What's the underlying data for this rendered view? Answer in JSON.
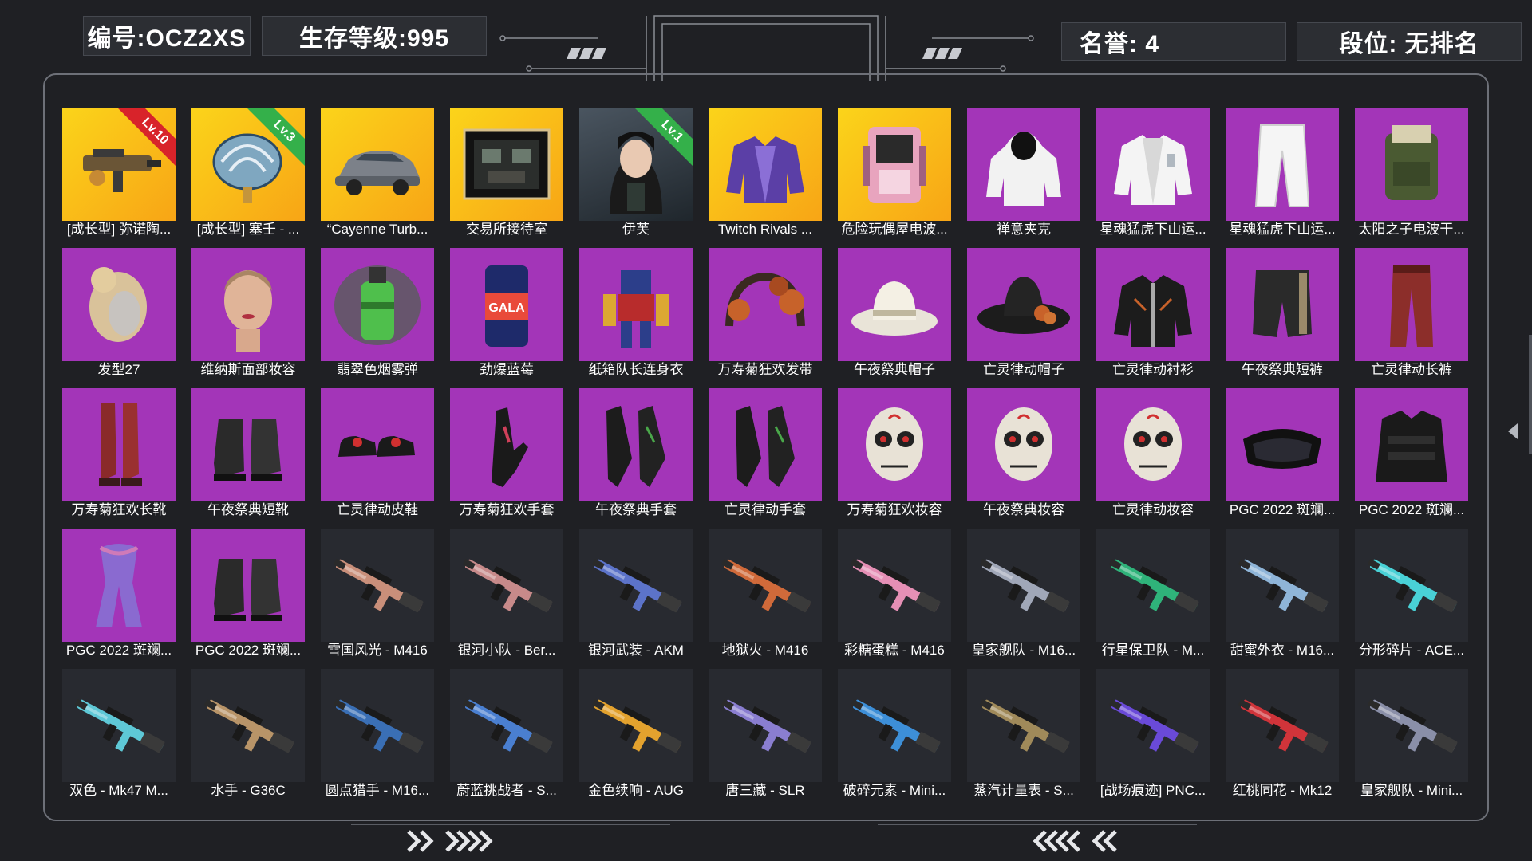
{
  "header": {
    "id_text": "编号:OCZ2XS",
    "level_text": "生存等级:995",
    "honor_text": "名誉: 4",
    "rank_text": "段位: 无排名"
  },
  "items": [
    {
      "label": "[成长型] 弥诺陶...",
      "bg": "gold",
      "icon": "smg-gun-icon",
      "badge": "Lv.10",
      "badge_color": "red"
    },
    {
      "label": "[成长型] 塞壬 - ...",
      "bg": "gold",
      "icon": "shell-ornament-icon",
      "badge": "Lv.3",
      "badge_color": "green"
    },
    {
      "label": "“Cayenne Turb...",
      "bg": "gold",
      "icon": "car-icon"
    },
    {
      "label": "交易所接待室",
      "bg": "gold",
      "icon": "room-scene-icon"
    },
    {
      "label": "伊芙",
      "bg": "photo",
      "icon": "character-portrait-icon",
      "badge": "Lv.1",
      "badge_color": "green"
    },
    {
      "label": "Twitch Rivals ...",
      "bg": "gold",
      "icon": "jacket-icon"
    },
    {
      "label": "危险玩偶屋电波...",
      "bg": "gold",
      "icon": "backpack-device-icon"
    },
    {
      "label": "禅意夹克",
      "bg": "purple",
      "icon": "hooded-jacket-icon"
    },
    {
      "label": "星魂猛虎下山运...",
      "bg": "purple",
      "icon": "sport-jacket-icon"
    },
    {
      "label": "星魂猛虎下山运...",
      "bg": "purple",
      "icon": "pants-icon"
    },
    {
      "label": "太阳之子电波干...",
      "bg": "purple",
      "icon": "backpack-icon"
    },
    {
      "label": "发型27",
      "bg": "purple",
      "icon": "hair-icon"
    },
    {
      "label": "维纳斯面部妆容",
      "bg": "purple",
      "icon": "face-icon"
    },
    {
      "label": "翡翠色烟雾弹",
      "bg": "purple",
      "icon": "smoke-grenade-icon"
    },
    {
      "label": "劲爆蓝莓",
      "bg": "purple",
      "icon": "can-icon"
    },
    {
      "label": "纸箱队长连身衣",
      "bg": "purple",
      "icon": "robot-suit-icon"
    },
    {
      "label": "万寿菊狂欢发带",
      "bg": "purple",
      "icon": "headband-icon"
    },
    {
      "label": "午夜祭典帽子",
      "bg": "purple",
      "icon": "hat-icon"
    },
    {
      "label": "亡灵律动帽子",
      "bg": "purple",
      "icon": "sombrero-icon"
    },
    {
      "label": "亡灵律动衬衫",
      "bg": "purple",
      "icon": "shirt-icon"
    },
    {
      "label": "午夜祭典短裤",
      "bg": "purple",
      "icon": "shorts-icon"
    },
    {
      "label": "亡灵律动长裤",
      "bg": "purple",
      "icon": "long-pants-icon"
    },
    {
      "label": "万寿菊狂欢长靴",
      "bg": "purple",
      "icon": "boots-icon"
    },
    {
      "label": "午夜祭典短靴",
      "bg": "purple",
      "icon": "short-boots-icon"
    },
    {
      "label": "亡灵律动皮鞋",
      "bg": "purple",
      "icon": "shoes-icon"
    },
    {
      "label": "万寿菊狂欢手套",
      "bg": "purple",
      "icon": "glove-icon"
    },
    {
      "label": "午夜祭典手套",
      "bg": "purple",
      "icon": "gloves-icon"
    },
    {
      "label": "亡灵律动手套",
      "bg": "purple",
      "icon": "gloves-icon"
    },
    {
      "label": "万寿菊狂欢妆容",
      "bg": "purple",
      "icon": "skull-makeup-icon"
    },
    {
      "label": "午夜祭典妆容",
      "bg": "purple",
      "icon": "skull-makeup-icon"
    },
    {
      "label": "亡灵律动妆容",
      "bg": "purple",
      "icon": "skull-makeup-icon"
    },
    {
      "label": "PGC 2022 斑斓...",
      "bg": "purple",
      "icon": "goggles-icon"
    },
    {
      "label": "PGC 2022 斑斓...",
      "bg": "purple",
      "icon": "vest-icon"
    },
    {
      "label": "PGC 2022 斑斓...",
      "bg": "purple",
      "icon": "scarf-icon"
    },
    {
      "label": "PGC 2022 斑斓...",
      "bg": "purple",
      "icon": "short-boots-icon"
    },
    {
      "label": "雪国风光 - M416",
      "bg": "dark",
      "icon": "rifle-icon",
      "accent": "#c98f7a"
    },
    {
      "label": "银河小队 - Ber...",
      "bg": "dark",
      "icon": "rifle-icon",
      "accent": "#c78a8a"
    },
    {
      "label": "银河武装 - AKM",
      "bg": "dark",
      "icon": "rifle-icon",
      "accent": "#5c73c9"
    },
    {
      "label": "地狱火 - M416",
      "bg": "dark",
      "icon": "rifle-icon",
      "accent": "#d06a3a"
    },
    {
      "label": "彩糖蛋糕 - M416",
      "bg": "dark",
      "icon": "rifle-icon",
      "accent": "#e58fb5"
    },
    {
      "label": "皇家舰队 - M16...",
      "bg": "dark",
      "icon": "rifle-icon",
      "accent": "#a0a7b8"
    },
    {
      "label": "行星保卫队 - M...",
      "bg": "dark",
      "icon": "rifle-icon",
      "accent": "#2fb37a"
    },
    {
      "label": "甜蜜外衣 - M16...",
      "bg": "dark",
      "icon": "rifle-icon",
      "accent": "#8fb5d8"
    },
    {
      "label": "分形碎片 - ACE...",
      "bg": "dark",
      "icon": "rifle-icon",
      "accent": "#49d1d6"
    },
    {
      "label": "双色 - Mk47 M...",
      "bg": "dark",
      "icon": "rifle-icon",
      "accent": "#5ec8d6"
    },
    {
      "label": "水手 - G36C",
      "bg": "dark",
      "icon": "rifle-icon",
      "accent": "#b89468"
    },
    {
      "label": "圆点猎手 - M16...",
      "bg": "dark",
      "icon": "rifle-icon",
      "accent": "#3a6fb5"
    },
    {
      "label": "蔚蓝挑战者 - S...",
      "bg": "dark",
      "icon": "rifle-icon",
      "accent": "#4a7fd0"
    },
    {
      "label": "金色续响 - AUG",
      "bg": "dark",
      "icon": "rifle-icon",
      "accent": "#e3a22e"
    },
    {
      "label": "唐三藏 - SLR",
      "bg": "dark",
      "icon": "rifle-icon",
      "accent": "#8a7ed0"
    },
    {
      "label": "破碎元素 - Mini...",
      "bg": "dark",
      "icon": "rifle-icon",
      "accent": "#3d8fd8"
    },
    {
      "label": "蒸汽计量表 - S...",
      "bg": "dark",
      "icon": "rifle-icon",
      "accent": "#a08a5a"
    },
    {
      "label": "[战场痕迹] PNC...",
      "bg": "dark",
      "icon": "rifle-icon",
      "accent": "#6a4ad8"
    },
    {
      "label": "红桃同花 - Mk12",
      "bg": "dark",
      "icon": "rifle-icon",
      "accent": "#d0343a"
    },
    {
      "label": "皇家舰队 - Mini...",
      "bg": "dark",
      "icon": "rifle-icon",
      "accent": "#8a8fa8"
    }
  ],
  "colors": {
    "gold": "#fbc41a",
    "purple": "#a335b8",
    "dark": "#282a30",
    "badge_red": "#d8232a",
    "badge_green": "#34b04a"
  }
}
